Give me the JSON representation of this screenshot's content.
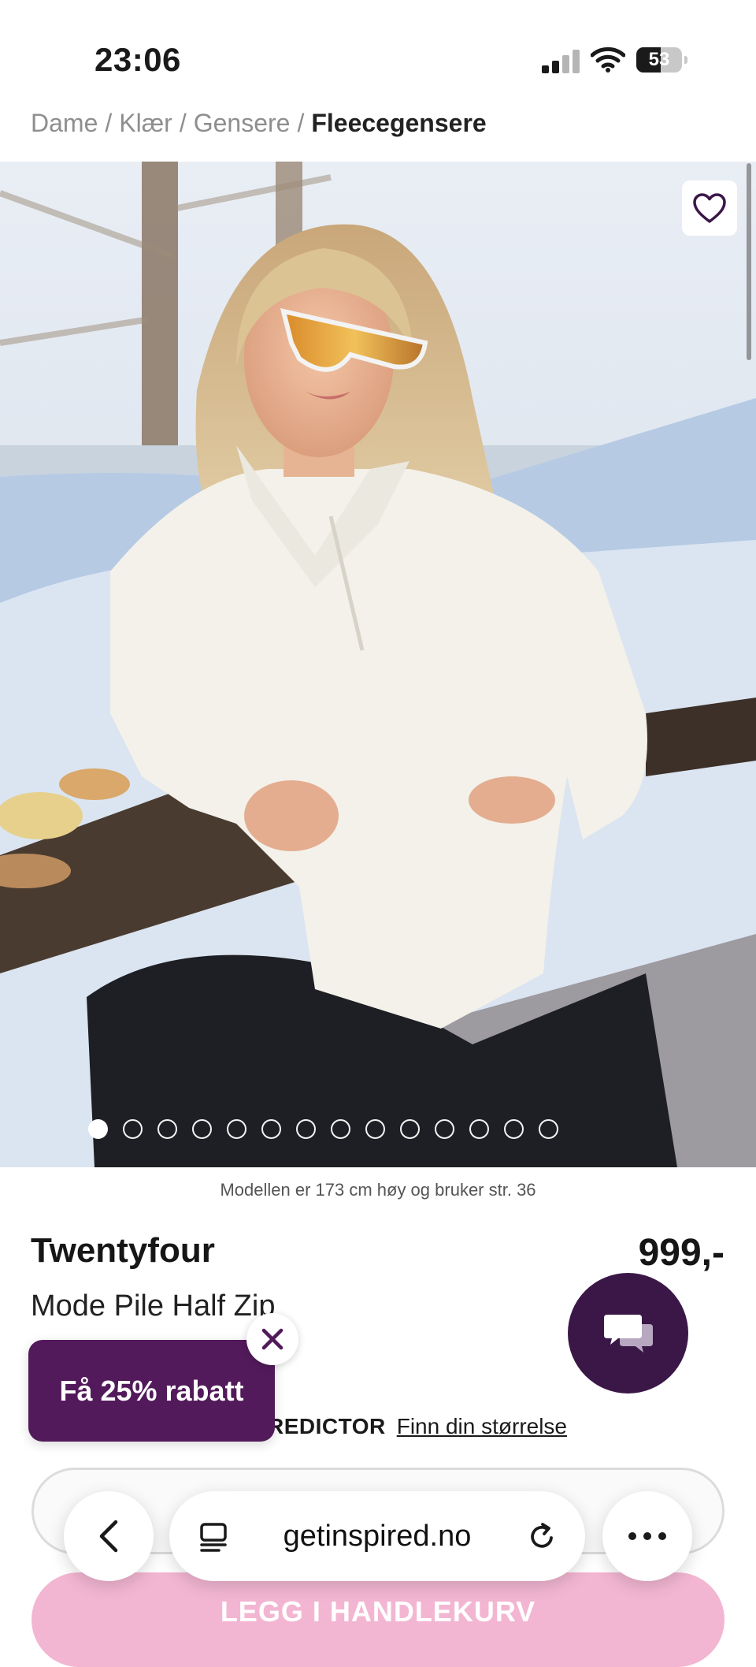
{
  "status_bar": {
    "time": "23:06",
    "battery": "53",
    "battery_level": 0.53
  },
  "breadcrumb": {
    "items": [
      "Dame",
      "Klær",
      "Gensere"
    ],
    "current": "Fleecegensere",
    "separator": "/"
  },
  "gallery": {
    "image_count": 14,
    "active_index": 0
  },
  "product": {
    "model_info": "Modellen er 173 cm høy og bruker str. 36",
    "brand": "Twentyfour",
    "name": "Mode Pile Half Zip",
    "price": "999,-"
  },
  "size": {
    "predictor_label": "REDICTOR",
    "find_size_link": "Finn din størrelse"
  },
  "promo": {
    "label": "Få 25% rabatt"
  },
  "actions": {
    "add_to_cart": "LEGG I HANDLEKURV"
  },
  "browser": {
    "domain": "getinspired.no"
  },
  "colors": {
    "accent": "#521a5a",
    "chat": "#3b1748",
    "cart_button": "#f3b6d2"
  }
}
